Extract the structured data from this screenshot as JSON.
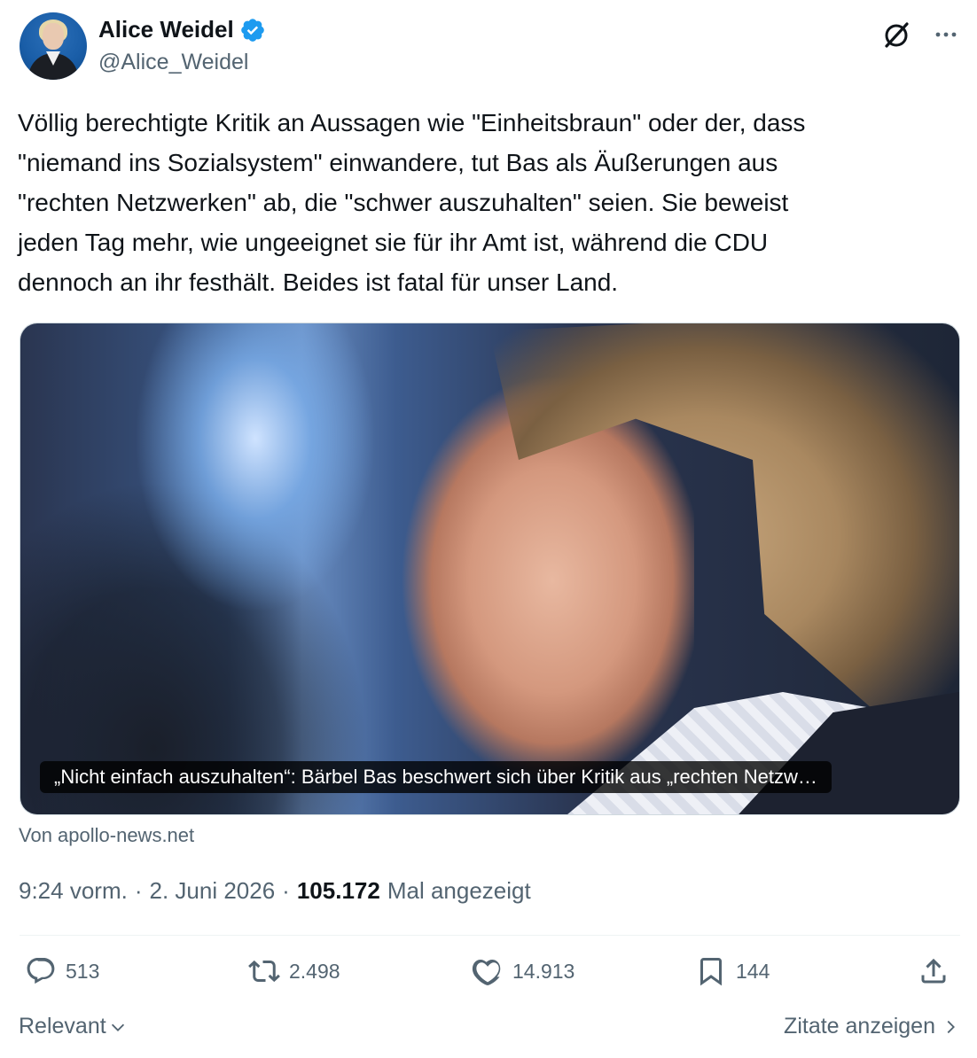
{
  "author": {
    "name": "Alice Weidel",
    "handle": "@Alice_Weidel"
  },
  "tweet": {
    "text": "Völlig berechtigte Kritik an Aussagen wie \"Einheitsbraun\" oder der, dass\n\"niemand ins Sozialsystem\" einwandere, tut Bas als Äußerungen aus\n\"rechten Netzwerken\" ab, die \"schwer auszuhalten\" seien. Sie beweist\njeden Tag mehr, wie ungeeignet sie für ihr Amt ist, während die CDU\ndennoch an ihr festhält. Beides ist fatal für unser Land."
  },
  "card": {
    "caption": "„Nicht einfach auszuhalten“: Bärbel Bas beschwert sich über Kritik aus „rechten Netzw…",
    "source": "Von apollo-news.net"
  },
  "meta": {
    "time": "9:24 vorm.",
    "sep1": "·",
    "date": "2. Juni 2026",
    "sep2": "·",
    "views": "105.172",
    "views_label": "Mal angezeigt"
  },
  "actions": {
    "replies": "513",
    "reposts": "2.498",
    "likes": "14.913",
    "bookmarks": "144"
  },
  "footer": {
    "sort_label": "Relevant",
    "quotes_label": "Zitate anzeigen"
  },
  "colors": {
    "verified": "#1d9bf0",
    "text_primary": "#0f1419",
    "text_secondary": "#536471"
  }
}
